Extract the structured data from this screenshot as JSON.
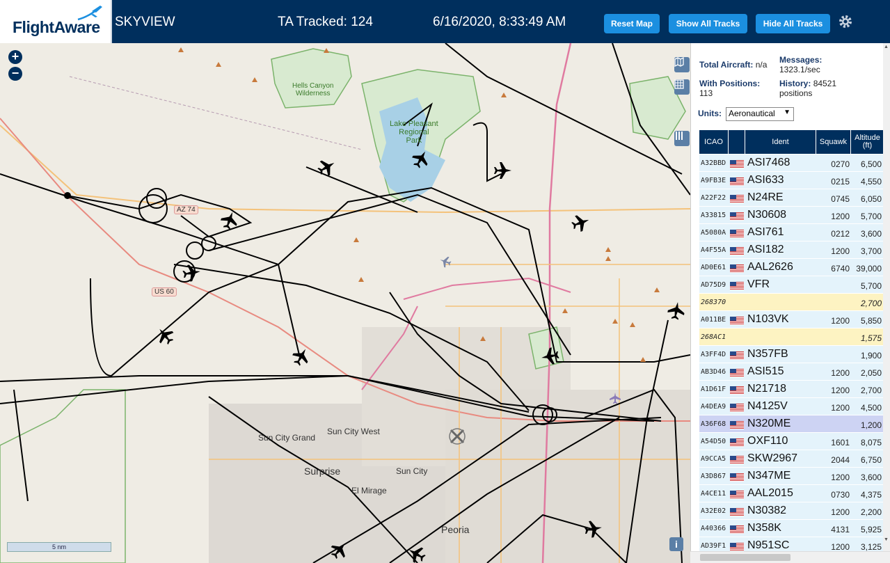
{
  "header": {
    "logo_text": "FlightAware",
    "title": "SKYVIEW",
    "tracked": "TA Tracked: 124",
    "datetime": "6/16/2020, 8:33:49 AM",
    "buttons": {
      "reset": "Reset Map",
      "show_all": "Show All Tracks",
      "hide_all": "Hide All Tracks"
    }
  },
  "map": {
    "labels": {
      "hells_canyon": "Hells Canyon\nWilderness",
      "lake_pleasant": "Lake Pleasant\nRegional\nPark",
      "sun_city_grand": "Sun City Grand",
      "sun_city_west": "Sun City West",
      "surprise": "Surprise",
      "sun_city": "Sun City",
      "el_mirage": "El Mirage",
      "peoria": "Peoria",
      "az74": "AZ 74",
      "us60": "US 60"
    },
    "scale": "5 nm"
  },
  "stats": {
    "total_aircraft_label": "Total Aircraft:",
    "total_aircraft_value": "n/a",
    "messages_label": "Messages:",
    "messages_value": "1323.1/sec",
    "with_positions_label": "With Positions:",
    "with_positions_value": "113",
    "history_label": "History:",
    "history_value": "84521",
    "history_unit": "positions"
  },
  "units": {
    "label": "Units:",
    "selected": "Aeronautical"
  },
  "table": {
    "headers": {
      "icao": "ICAO",
      "ident": "Ident",
      "squawk": "Squawk",
      "altitude": "Altitude\n(ft)"
    },
    "rows": [
      {
        "icao": "A32BBD",
        "ident": "ASI7468",
        "squawk": "0270",
        "alt": "6,500",
        "style": "blue",
        "flag": true
      },
      {
        "icao": "A9FB3E",
        "ident": "ASI633",
        "squawk": "0215",
        "alt": "4,550",
        "style": "blue",
        "flag": true
      },
      {
        "icao": "A22F22",
        "ident": "N24RE",
        "squawk": "0745",
        "alt": "6,050",
        "style": "blue",
        "flag": true
      },
      {
        "icao": "A33815",
        "ident": "N30608",
        "squawk": "1200",
        "alt": "5,700",
        "style": "blue",
        "flag": true
      },
      {
        "icao": "A5080A",
        "ident": "ASI761",
        "squawk": "0212",
        "alt": "3,600",
        "style": "blue",
        "flag": true
      },
      {
        "icao": "A4F55A",
        "ident": "ASI182",
        "squawk": "1200",
        "alt": "3,700",
        "style": "blue",
        "flag": true
      },
      {
        "icao": "AD0E61",
        "ident": "AAL2626",
        "squawk": "6740",
        "alt": "39,000",
        "style": "blue",
        "flag": true
      },
      {
        "icao": "AD75D9",
        "ident": "VFR",
        "squawk": "",
        "alt": "5,700",
        "style": "blue",
        "flag": true
      },
      {
        "icao": "268370",
        "ident": "",
        "squawk": "",
        "alt": "2,700",
        "style": "yellow",
        "flag": false
      },
      {
        "icao": "A011BE",
        "ident": "N103VK",
        "squawk": "1200",
        "alt": "5,850",
        "style": "blue",
        "flag": true
      },
      {
        "icao": "268AC1",
        "ident": "",
        "squawk": "",
        "alt": "1,575",
        "style": "yellow",
        "flag": false
      },
      {
        "icao": "A3FF4D",
        "ident": "N357FB",
        "squawk": "",
        "alt": "1,900",
        "style": "blue",
        "flag": true
      },
      {
        "icao": "AB3D46",
        "ident": "ASI515",
        "squawk": "1200",
        "alt": "2,050",
        "style": "blue",
        "flag": true
      },
      {
        "icao": "A1D61F",
        "ident": "N21718",
        "squawk": "1200",
        "alt": "2,700",
        "style": "blue",
        "flag": true
      },
      {
        "icao": "A4DEA9",
        "ident": "N4125V",
        "squawk": "1200",
        "alt": "4,500",
        "style": "blue",
        "flag": true
      },
      {
        "icao": "A36F68",
        "ident": "N320ME",
        "squawk": "",
        "alt": "1,200",
        "style": "sel",
        "flag": true
      },
      {
        "icao": "A54D50",
        "ident": "OXF110",
        "squawk": "1601",
        "alt": "8,075",
        "style": "blue",
        "flag": true
      },
      {
        "icao": "A9CCA5",
        "ident": "SKW2967",
        "squawk": "2044",
        "alt": "6,750",
        "style": "blue",
        "flag": true
      },
      {
        "icao": "A3D867",
        "ident": "N347ME",
        "squawk": "1200",
        "alt": "3,600",
        "style": "blue",
        "flag": true
      },
      {
        "icao": "A4CE11",
        "ident": "AAL2015",
        "squawk": "0730",
        "alt": "4,375",
        "style": "blue",
        "flag": true
      },
      {
        "icao": "A32E02",
        "ident": "N30382",
        "squawk": "1200",
        "alt": "2,200",
        "style": "blue",
        "flag": true
      },
      {
        "icao": "A40366",
        "ident": "N358K",
        "squawk": "4131",
        "alt": "5,925",
        "style": "blue",
        "flag": true
      },
      {
        "icao": "AD39F1",
        "ident": "N951SC",
        "squawk": "1200",
        "alt": "3,125",
        "style": "blue",
        "flag": true
      }
    ]
  }
}
